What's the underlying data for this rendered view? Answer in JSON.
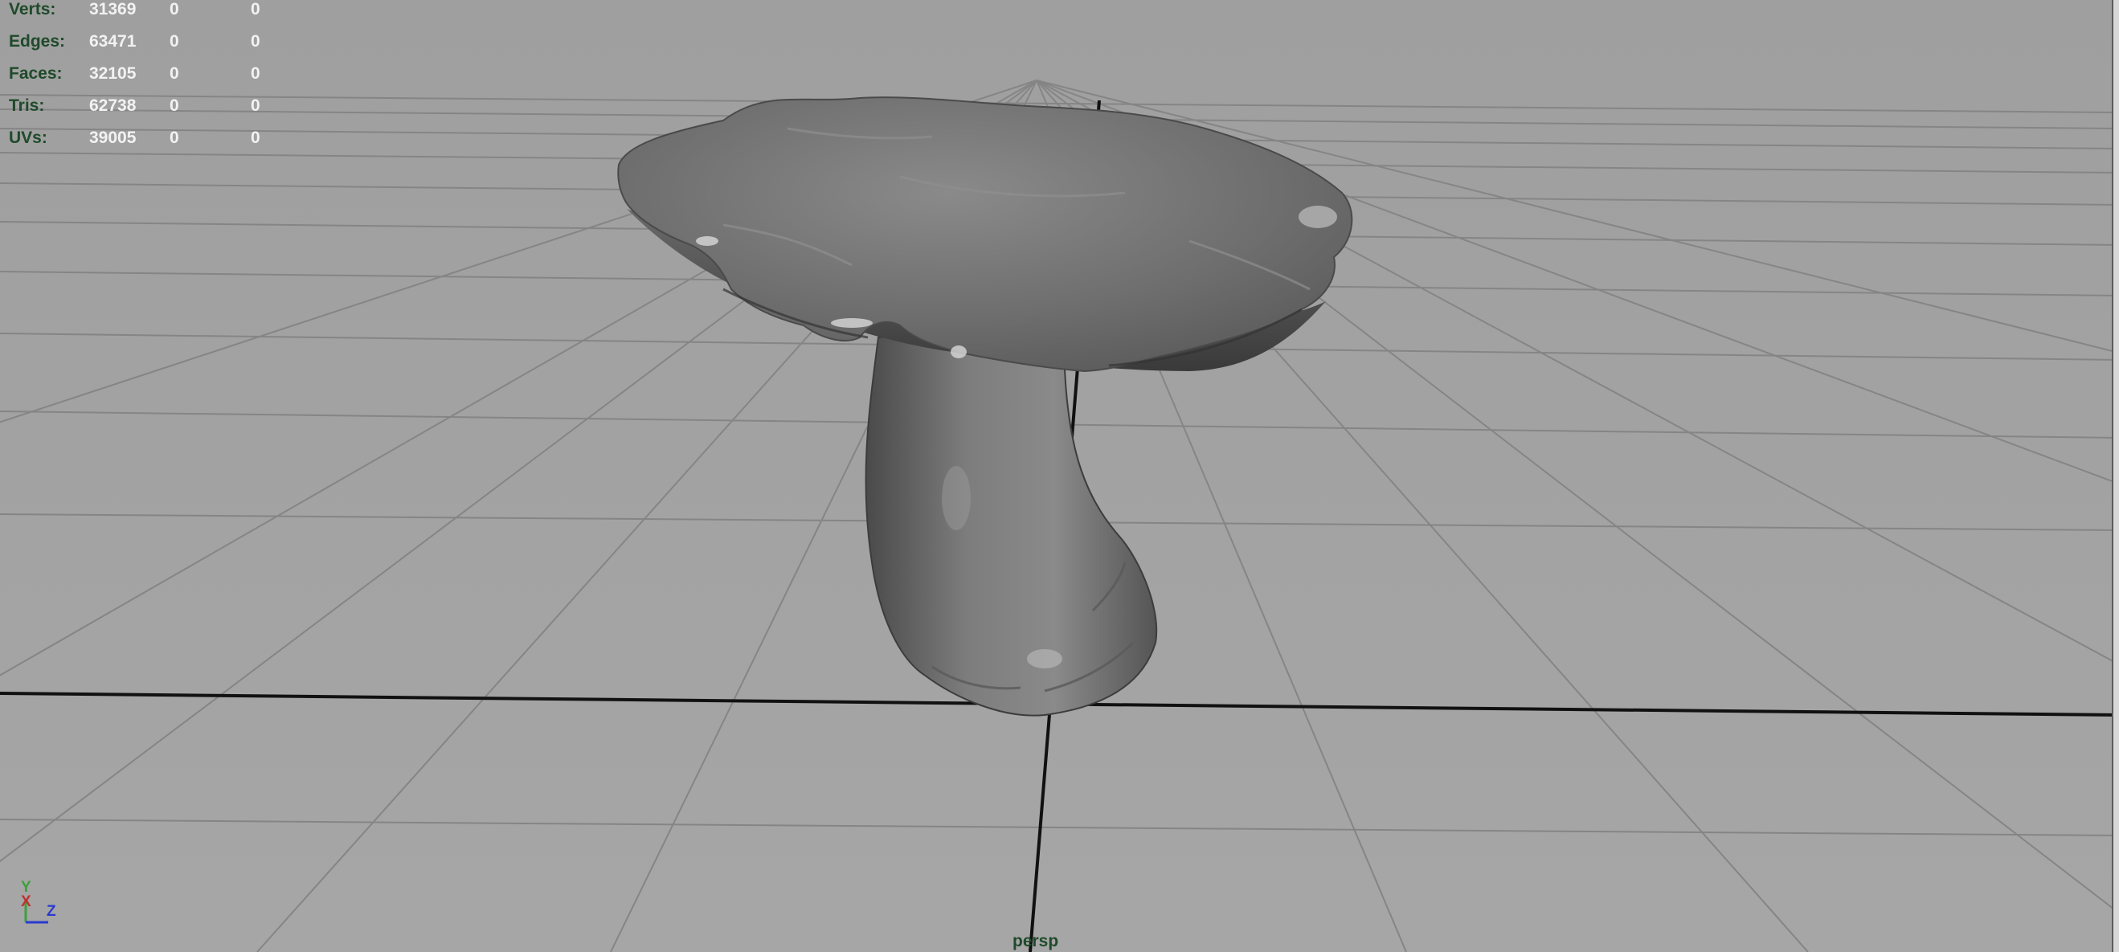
{
  "viewport": {
    "camera": "persp",
    "background_color": "#a1a1a1",
    "grid_color": "#8a8a8a",
    "axis_line_color": "#111111"
  },
  "heads_up_display": {
    "rows": [
      {
        "label": "Verts:",
        "values": [
          "31369",
          "0",
          "0"
        ]
      },
      {
        "label": "Edges:",
        "values": [
          "63471",
          "0",
          "0"
        ]
      },
      {
        "label": "Faces:",
        "values": [
          "32105",
          "0",
          "0"
        ]
      },
      {
        "label": "Tris:",
        "values": [
          "62738",
          "0",
          "0"
        ]
      },
      {
        "label": "UVs:",
        "values": [
          "39005",
          "0",
          "0"
        ]
      }
    ],
    "label_color": "#1f4a2b",
    "value_color": "#f2f2f2"
  },
  "axis_gizmo": {
    "y": "Y",
    "x": "X",
    "z": "Z",
    "y_color": "#3ca03c",
    "x_color": "#c03030",
    "z_color": "#2a3ad0"
  },
  "scene_object": {
    "icon": "mushroom-mesh-icon"
  }
}
